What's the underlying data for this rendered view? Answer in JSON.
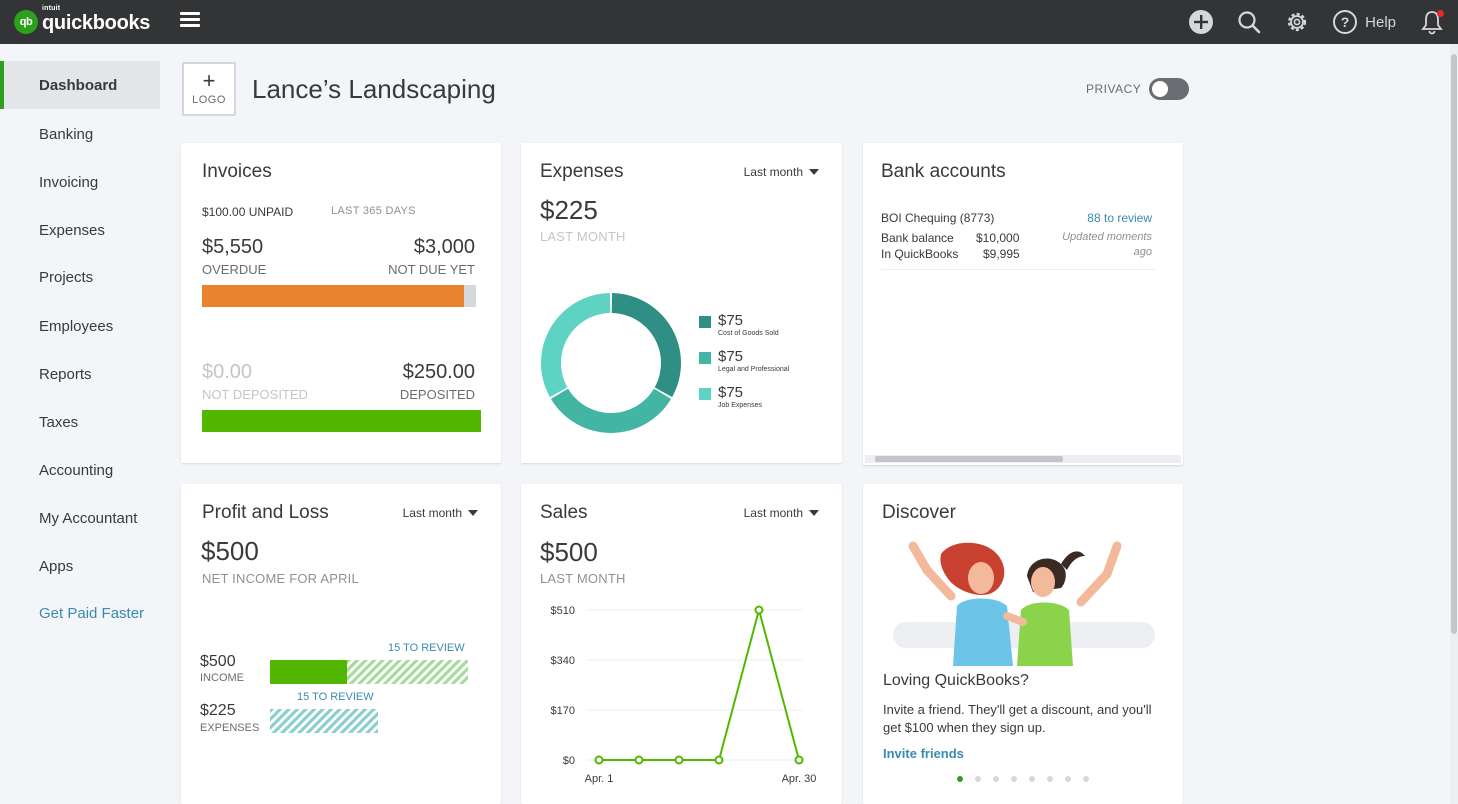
{
  "app": {
    "brand_intuit": "intuit",
    "brand_name": "quickbooks",
    "brand_badge": "qb"
  },
  "topbar": {
    "help_label": "Help",
    "icons": [
      "plus-circle-icon",
      "search-icon",
      "gear-icon",
      "help-icon",
      "bell-icon"
    ]
  },
  "sidebar": {
    "items": [
      {
        "label": "Dashboard",
        "active": true
      },
      {
        "label": "Banking"
      },
      {
        "label": "Invoicing"
      },
      {
        "label": "Expenses"
      },
      {
        "label": "Projects"
      },
      {
        "label": "Employees"
      },
      {
        "label": "Reports"
      },
      {
        "label": "Taxes"
      },
      {
        "label": "Accounting"
      },
      {
        "label": "My Accountant"
      },
      {
        "label": "Apps"
      },
      {
        "label": "Get Paid Faster"
      }
    ]
  },
  "header": {
    "logo_plus": "+",
    "logo_label": "LOGO",
    "company_name": "Lance’s Landscaping",
    "privacy_label": "PRIVACY",
    "privacy_on": false
  },
  "invoices": {
    "title": "Invoices",
    "unpaid": "$100.00 UNPAID",
    "range": "LAST 365 DAYS",
    "overdue_value": "$5,550",
    "overdue_label": "OVERDUE",
    "notdue_value": "$3,000",
    "notdue_label": "NOT DUE YET",
    "notdeposited_value": "$0.00",
    "notdeposited_label": "NOT DEPOSITED",
    "deposited_value": "$250.00",
    "deposited_label": "DEPOSITED",
    "colors": {
      "overdue": "#e8842f",
      "not_due": "#d4d7dc",
      "deposited": "#53b700"
    }
  },
  "expenses": {
    "title": "Expenses",
    "period": "Last month",
    "total": "$225",
    "total_label": "LAST MONTH",
    "legend": [
      {
        "value": "$75",
        "name": "Cost of Goods Sold",
        "color": "#2f8f84"
      },
      {
        "value": "$75",
        "name": "Legal and Professional",
        "color": "#43b6a3"
      },
      {
        "value": "$75",
        "name": "Job Expenses",
        "color": "#5fd3c3"
      }
    ]
  },
  "bank": {
    "title": "Bank accounts",
    "account_name": "BOI Chequing (8773)",
    "review_link": "88 to review",
    "bank_balance_label": "Bank balance",
    "bank_balance": "$10,000",
    "in_qb_label": "In QuickBooks",
    "in_qb": "$9,995",
    "updated_note": "Updated moments ago"
  },
  "profit_loss": {
    "title": "Profit and Loss",
    "period": "Last month",
    "net_income": "$500",
    "net_label": "NET INCOME FOR APRIL",
    "income_value": "$500",
    "income_label": "INCOME",
    "income_review": "15 TO REVIEW",
    "expenses_value": "$225",
    "expenses_label": "EXPENSES",
    "expenses_review": "15 TO REVIEW",
    "income_color": "#53b700",
    "expenses_color": "#8bd0cf"
  },
  "sales": {
    "title": "Sales",
    "period": "Last month",
    "total": "$500",
    "total_label": "LAST MONTH"
  },
  "chart_data": {
    "type": "line",
    "x": [
      "Apr. 1",
      "",
      "",
      "",
      "",
      "Apr. 30"
    ],
    "values": [
      0,
      0,
      0,
      0,
      510,
      0
    ],
    "y_ticks": [
      "$510",
      "$340",
      "$170",
      "$0"
    ],
    "x_tick_labels": [
      "Apr. 1",
      "Apr. 30"
    ],
    "ylim": [
      0,
      510
    ],
    "grid": true,
    "color": "#53b700"
  },
  "discover": {
    "title": "Discover",
    "headline": "Loving QuickBooks?",
    "text": "Invite a friend. They'll get a discount, and you'll get $100 when they sign up.",
    "link": "Invite friends",
    "dots": 8,
    "active_dot": 0
  }
}
